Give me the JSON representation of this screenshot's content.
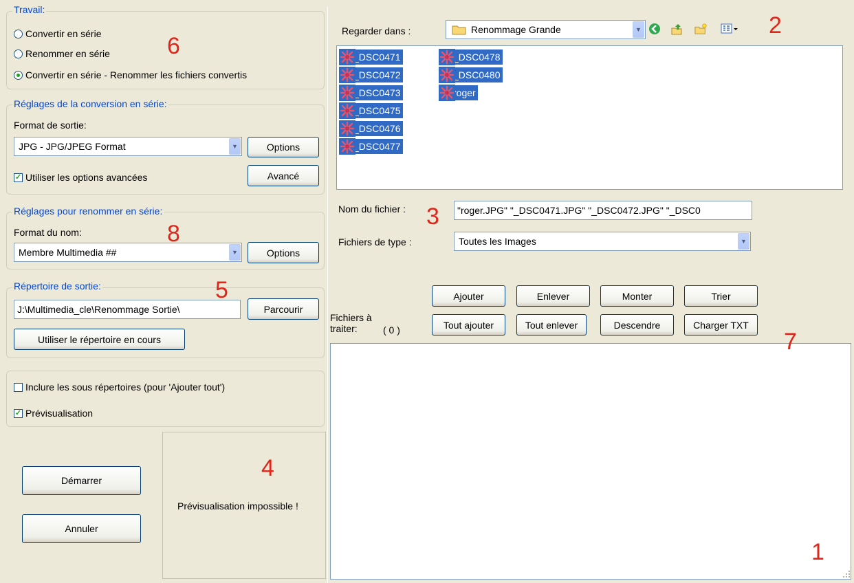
{
  "job": {
    "legend": "Travail:",
    "options": [
      {
        "label": "Convertir en série",
        "selected": false
      },
      {
        "label": "Renommer en série",
        "selected": false
      },
      {
        "label": "Convertir en série - Renommer les fichiers convertis",
        "selected": true
      }
    ]
  },
  "conversion": {
    "legend": "Réglages de la conversion en série:",
    "format_label": "Format de sortie:",
    "format_value": "JPG - JPG/JPEG Format",
    "options_button": "Options",
    "advanced_checkbox": {
      "label": "Utiliser les options avancées",
      "checked": true
    },
    "advanced_button": "Avancé"
  },
  "rename": {
    "legend": "Réglages pour renommer en série:",
    "format_label": "Format du nom:",
    "format_value": "Membre Multimedia ##",
    "options_button": "Options"
  },
  "output": {
    "legend": "Répertoire de sortie:",
    "path": "J:\\Multimedia_cle\\Renommage Sortie\\",
    "browse_button": "Parcourir",
    "use_current_button": "Utiliser le répertoire en cours"
  },
  "extras": {
    "include_subdirs": {
      "label": "Inclure les sous répertoires (pour 'Ajouter tout')",
      "checked": false
    },
    "preview": {
      "label": "Prévisualisation",
      "checked": true
    }
  },
  "actions": {
    "start": "Démarrer",
    "cancel": "Annuler"
  },
  "preview_text": "Prévisualisation impossible !",
  "browser": {
    "look_in_label": "Regarder dans :",
    "look_in_value": "Renommage Grande",
    "files_col1": [
      "_DSC0471",
      "_DSC0472",
      "_DSC0473",
      "_DSC0475",
      "_DSC0476",
      "_DSC0477"
    ],
    "files_col2": [
      "_DSC0478",
      "_DSC0480",
      "roger"
    ],
    "filename_label": "Nom du fichier :",
    "filename_value": "\"roger.JPG\" \"_DSC0471.JPG\" \"_DSC0472.JPG\" \"_DSC0",
    "filetype_label": "Fichiers de type :",
    "filetype_value": "Toutes les Images"
  },
  "queue": {
    "buttons_row1": [
      "Ajouter",
      "Enlever",
      "Monter",
      "Trier"
    ],
    "buttons_row2": [
      "Tout ajouter",
      "Tout enlever",
      "Descendre",
      "Charger TXT"
    ],
    "label": "Fichiers à traiter:",
    "count": "( 0 )"
  },
  "annotations": [
    "1",
    "2",
    "3",
    "4",
    "5",
    "6",
    "7",
    "8"
  ],
  "colors": {
    "window_bg": "#ece9d8",
    "legend_text": "#0046d5",
    "selection": "#316ac5",
    "annotation": "#e0261a"
  }
}
